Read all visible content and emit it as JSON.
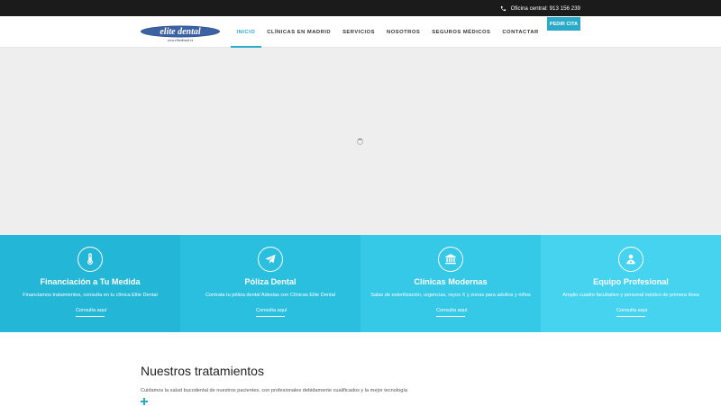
{
  "topbar": {
    "phone_icon": "phone-icon",
    "contact_text": "Oficina central: 913 156 239"
  },
  "header": {
    "logo": {
      "name": "elite dental",
      "url_text": "www.elitedental.es"
    },
    "nav": [
      {
        "label": "INICIO",
        "active": true
      },
      {
        "label": "CLÍNICAS EN MADRID",
        "active": false
      },
      {
        "label": "SERVICIOS",
        "active": false
      },
      {
        "label": "NOSOTROS",
        "active": false
      },
      {
        "label": "SEGUROS MÉDICOS",
        "active": false
      },
      {
        "label": "CONTACTAR",
        "active": false
      }
    ],
    "cta_label": "PEDIR CITA"
  },
  "features": [
    {
      "icon": "thermometer-icon",
      "title": "Financiación a Tu Medida",
      "description": "Financiamos tratamientos, consulta en tu clínica Elite Dental",
      "link": "Consulta aquí",
      "color": "#23b6d6"
    },
    {
      "icon": "paper-plane-icon",
      "title": "Póliza Dental",
      "description": "Contrata tu póliza dental Adeslas con Clínicas Elite Dental",
      "link": "Consulta aquí",
      "color": "#2bbfdf"
    },
    {
      "icon": "building-icon",
      "title": "Clínicas Modernas",
      "description": "Salas de esterilización, urgencias, rayos X y zonas para adultos y niños",
      "link": "Consulta aquí",
      "color": "#36c8e7"
    },
    {
      "icon": "doctor-icon",
      "title": "Equipo Profesional",
      "description": "Amplio cuadro facultativo y personal médico de primera línea",
      "link": "Consulta aquí",
      "color": "#45d3f0"
    }
  ],
  "treatments": {
    "title": "Nuestros tratamientos",
    "description": "Cuidamos la salud bucodental de nuestros pacientes, con profesionales debidamente cualificados y la mejor tecnología",
    "plus_icon": "plus-icon"
  },
  "colors": {
    "accent": "#2aa9c9",
    "topbar": "#1b1b1b",
    "hero_background": "#eeeeee"
  }
}
